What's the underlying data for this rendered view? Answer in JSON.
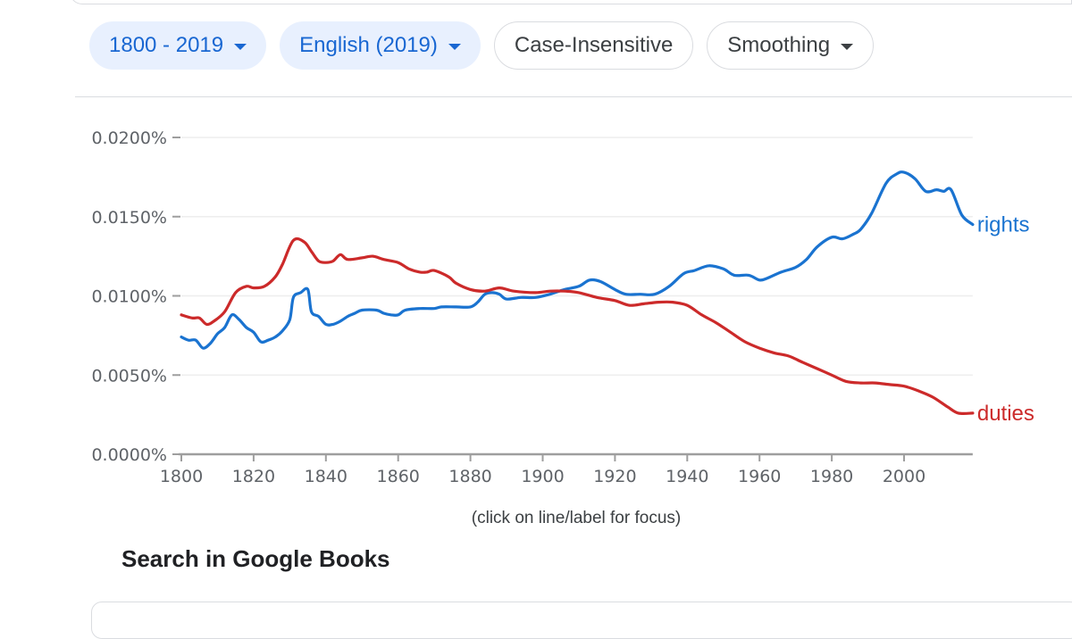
{
  "filters": {
    "year_range": "1800 - 2019",
    "corpus": "English (2019)",
    "case": "Case-Insensitive",
    "smoothing": "Smoothing"
  },
  "chart_note": "(click on line/label for focus)",
  "books_section": {
    "title": "Search in Google Books"
  },
  "chart_data": {
    "type": "line",
    "title": "",
    "xlabel": "",
    "ylabel": "",
    "xlim": [
      1800,
      2019
    ],
    "ylim": [
      0,
      0.02
    ],
    "x_ticks": [
      1800,
      1820,
      1840,
      1860,
      1880,
      1900,
      1920,
      1940,
      1960,
      1980,
      2000
    ],
    "y_ticks": [
      0.0,
      0.005,
      0.01,
      0.015,
      0.02
    ],
    "y_tick_labels": [
      "0.0000%",
      "0.0050%",
      "0.0100%",
      "0.0150%",
      "0.0200%"
    ],
    "grid": true,
    "legend": "end-of-line labels (right)",
    "series": [
      {
        "name": "rights",
        "color": "#1a73d0",
        "points": [
          [
            1800,
            0.0074
          ],
          [
            1802,
            0.0072
          ],
          [
            1804,
            0.0072
          ],
          [
            1806,
            0.0067
          ],
          [
            1808,
            0.007
          ],
          [
            1810,
            0.0076
          ],
          [
            1812,
            0.008
          ],
          [
            1814,
            0.0088
          ],
          [
            1816,
            0.0085
          ],
          [
            1818,
            0.008
          ],
          [
            1820,
            0.0077
          ],
          [
            1822,
            0.0071
          ],
          [
            1824,
            0.0072
          ],
          [
            1826,
            0.0074
          ],
          [
            1828,
            0.0078
          ],
          [
            1830,
            0.0085
          ],
          [
            1831,
            0.0099
          ],
          [
            1833,
            0.0102
          ],
          [
            1835,
            0.0104
          ],
          [
            1836,
            0.009
          ],
          [
            1838,
            0.0087
          ],
          [
            1840,
            0.0082
          ],
          [
            1842,
            0.0082
          ],
          [
            1844,
            0.0084
          ],
          [
            1846,
            0.0087
          ],
          [
            1848,
            0.0089
          ],
          [
            1850,
            0.0091
          ],
          [
            1854,
            0.0091
          ],
          [
            1856,
            0.0089
          ],
          [
            1858,
            0.0088
          ],
          [
            1860,
            0.0088
          ],
          [
            1862,
            0.0091
          ],
          [
            1866,
            0.0092
          ],
          [
            1870,
            0.0092
          ],
          [
            1872,
            0.0093
          ],
          [
            1876,
            0.0093
          ],
          [
            1880,
            0.0093
          ],
          [
            1882,
            0.0096
          ],
          [
            1884,
            0.0101
          ],
          [
            1886,
            0.0102
          ],
          [
            1888,
            0.0101
          ],
          [
            1890,
            0.0098
          ],
          [
            1894,
            0.0099
          ],
          [
            1898,
            0.0099
          ],
          [
            1902,
            0.0101
          ],
          [
            1906,
            0.0104
          ],
          [
            1910,
            0.0106
          ],
          [
            1913,
            0.011
          ],
          [
            1916,
            0.0109
          ],
          [
            1920,
            0.0104
          ],
          [
            1923,
            0.0101
          ],
          [
            1927,
            0.0101
          ],
          [
            1931,
            0.0101
          ],
          [
            1935,
            0.0106
          ],
          [
            1939,
            0.0114
          ],
          [
            1942,
            0.0116
          ],
          [
            1946,
            0.0119
          ],
          [
            1950,
            0.0117
          ],
          [
            1953,
            0.0113
          ],
          [
            1957,
            0.0113
          ],
          [
            1960,
            0.011
          ],
          [
            1962,
            0.0111
          ],
          [
            1966,
            0.0115
          ],
          [
            1970,
            0.0118
          ],
          [
            1973,
            0.0123
          ],
          [
            1976,
            0.0131
          ],
          [
            1980,
            0.0137
          ],
          [
            1983,
            0.0136
          ],
          [
            1986,
            0.0139
          ],
          [
            1988,
            0.0142
          ],
          [
            1991,
            0.0152
          ],
          [
            1995,
            0.0171
          ],
          [
            1998,
            0.0177
          ],
          [
            2000,
            0.0178
          ],
          [
            2003,
            0.0174
          ],
          [
            2006,
            0.0166
          ],
          [
            2009,
            0.0167
          ],
          [
            2011,
            0.0166
          ],
          [
            2013,
            0.0167
          ],
          [
            2016,
            0.0151
          ],
          [
            2019,
            0.0145
          ]
        ]
      },
      {
        "name": "duties",
        "color": "#cc2a2a",
        "points": [
          [
            1800,
            0.0088
          ],
          [
            1803,
            0.0086
          ],
          [
            1805,
            0.0086
          ],
          [
            1807,
            0.0082
          ],
          [
            1809,
            0.0084
          ],
          [
            1812,
            0.009
          ],
          [
            1815,
            0.0102
          ],
          [
            1818,
            0.0106
          ],
          [
            1820,
            0.0105
          ],
          [
            1823,
            0.0106
          ],
          [
            1826,
            0.0112
          ],
          [
            1828,
            0.012
          ],
          [
            1831,
            0.0135
          ],
          [
            1834,
            0.0134
          ],
          [
            1836,
            0.0128
          ],
          [
            1838,
            0.0122
          ],
          [
            1840,
            0.0121
          ],
          [
            1842,
            0.0122
          ],
          [
            1844,
            0.0126
          ],
          [
            1846,
            0.0123
          ],
          [
            1850,
            0.0124
          ],
          [
            1853,
            0.0125
          ],
          [
            1856,
            0.0123
          ],
          [
            1860,
            0.0121
          ],
          [
            1863,
            0.0117
          ],
          [
            1866,
            0.0115
          ],
          [
            1868,
            0.0115
          ],
          [
            1870,
            0.0116
          ],
          [
            1874,
            0.0112
          ],
          [
            1876,
            0.0108
          ],
          [
            1880,
            0.0104
          ],
          [
            1884,
            0.0103
          ],
          [
            1888,
            0.0105
          ],
          [
            1892,
            0.0103
          ],
          [
            1898,
            0.0102
          ],
          [
            1902,
            0.0103
          ],
          [
            1906,
            0.0103
          ],
          [
            1910,
            0.0102
          ],
          [
            1915,
            0.0099
          ],
          [
            1920,
            0.0097
          ],
          [
            1924,
            0.0094
          ],
          [
            1928,
            0.0095
          ],
          [
            1932,
            0.0096
          ],
          [
            1936,
            0.0096
          ],
          [
            1940,
            0.0094
          ],
          [
            1944,
            0.0088
          ],
          [
            1948,
            0.0083
          ],
          [
            1952,
            0.0077
          ],
          [
            1956,
            0.0071
          ],
          [
            1960,
            0.0067
          ],
          [
            1964,
            0.0064
          ],
          [
            1968,
            0.0062
          ],
          [
            1972,
            0.0058
          ],
          [
            1976,
            0.0054
          ],
          [
            1980,
            0.005
          ],
          [
            1984,
            0.0046
          ],
          [
            1988,
            0.0045
          ],
          [
            1992,
            0.0045
          ],
          [
            1996,
            0.0044
          ],
          [
            2000,
            0.0043
          ],
          [
            2004,
            0.004
          ],
          [
            2008,
            0.0036
          ],
          [
            2012,
            0.003
          ],
          [
            2015,
            0.0026
          ],
          [
            2019,
            0.0026
          ]
        ]
      }
    ]
  }
}
